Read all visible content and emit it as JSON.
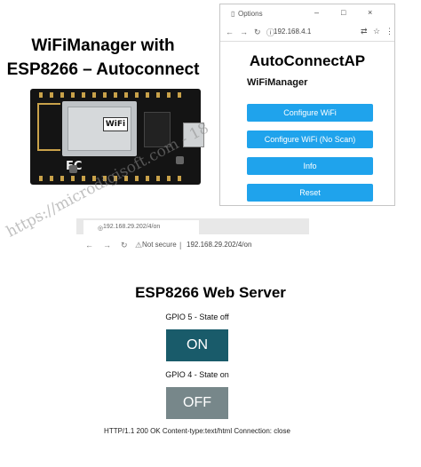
{
  "headline": {
    "line1": "WiFiManager with",
    "line2": "ESP8266 – Autoconnect"
  },
  "board": {
    "logo_text": "WiFi",
    "fc_text": "FC"
  },
  "top_browser": {
    "tab_title": "Options",
    "window_controls": [
      "–",
      "□",
      "×"
    ],
    "url": "192.168.4.1",
    "page": {
      "title": "AutoConnectAP",
      "section_label": "WiFiManager",
      "buttons": [
        "Configure WiFi",
        "Configure WiFi (No Scan)",
        "Info",
        "Reset"
      ],
      "button_color": "#1fa3ec"
    }
  },
  "bottom_browser": {
    "tab_title": "192.168.29.202/4/on",
    "security_label": "Not secure",
    "url": "192.168.29.202/4/on"
  },
  "web_server": {
    "title": "ESP8266 Web Server",
    "gpio5_label": "GPIO 5 - State off",
    "gpio5_button": "ON",
    "gpio4_label": "GPIO 4 - State on",
    "gpio4_button": "OFF",
    "footer": "HTTP/1.1 200 OK Content-type:text/html Connection: close",
    "on_color": "#195b6a",
    "off_color": "#77878a"
  },
  "watermark": "https://microdigisoft.com - 18"
}
